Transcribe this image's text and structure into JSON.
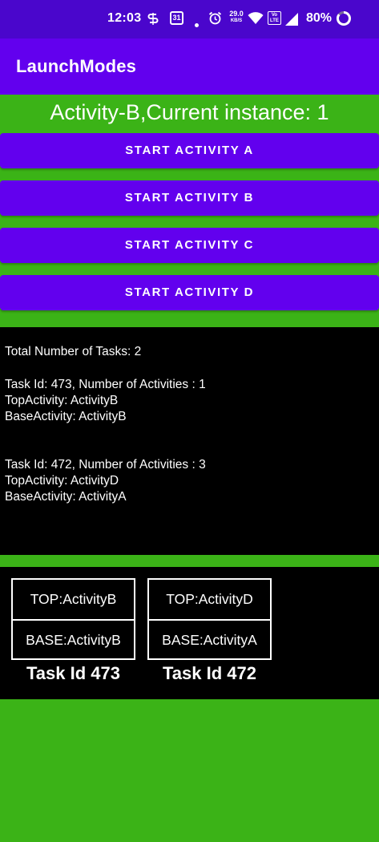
{
  "status_bar": {
    "time": "12:03",
    "calendar_day": "31",
    "network_speed_value": "29.0",
    "network_speed_unit": "KB/S",
    "volte_label": "Vo LTE",
    "battery_percent": "80%",
    "icons": [
      "s-notification-icon",
      "calendar-icon",
      "dot-icon",
      "alarm-icon",
      "wifi-icon",
      "volte-icon",
      "signal-icon",
      "battery-icon"
    ]
  },
  "app_bar": {
    "title": "LaunchModes",
    "color": "#6200ee"
  },
  "main": {
    "heading": "Activity-B,Current instance: 1",
    "background_color": "#3bb317",
    "buttons": [
      {
        "label": "START ACTIVITY A"
      },
      {
        "label": "START ACTIVITY B"
      },
      {
        "label": "START ACTIVITY C"
      },
      {
        "label": "START ACTIVITY D"
      }
    ]
  },
  "task_info": {
    "total": "Total Number of Tasks: 2",
    "tasks": [
      {
        "summary": "Task Id: 473, Number of Activities : 1",
        "top": "TopActivity: ActivityB",
        "base": "BaseActivity: ActivityB"
      },
      {
        "summary": "Task Id: 472, Number of Activities : 3",
        "top": "TopActivity: ActivityD",
        "base": "BaseActivity: ActivityA"
      }
    ]
  },
  "task_diagram": [
    {
      "top": "TOP:ActivityB",
      "base": "BASE:ActivityB",
      "caption": "Task Id 473"
    },
    {
      "top": "TOP:ActivityD",
      "base": "BASE:ActivityA",
      "caption": "Task Id 472"
    }
  ]
}
